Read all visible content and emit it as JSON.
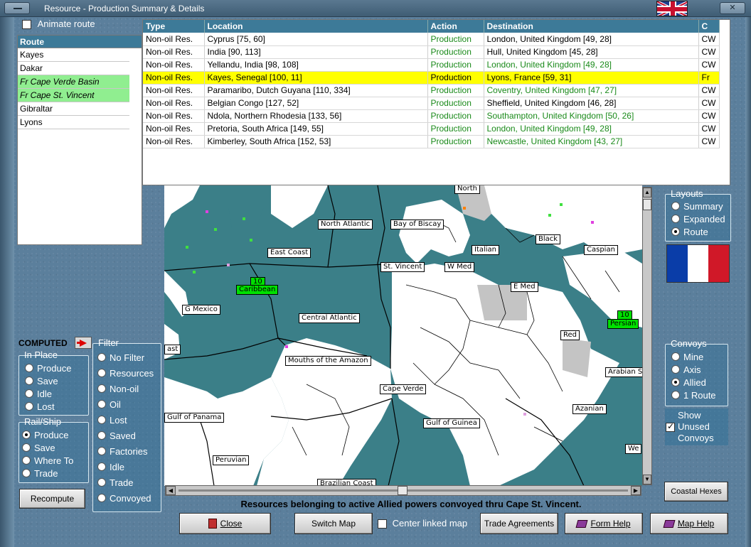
{
  "window": {
    "title": "Resource - Production Summary & Details"
  },
  "animate_route": {
    "label": "Animate route",
    "checked": false
  },
  "route_list": {
    "header": "Route",
    "items": [
      {
        "label": "Kayes",
        "highlight": false
      },
      {
        "label": "Dakar",
        "highlight": false
      },
      {
        "label": "Fr Cape Verde Basin",
        "highlight": true
      },
      {
        "label": "Fr Cape St. Vincent",
        "highlight": true
      },
      {
        "label": "Gibraltar",
        "highlight": false
      },
      {
        "label": "Lyons",
        "highlight": false
      }
    ]
  },
  "table": {
    "columns": [
      "Type",
      "Location",
      "Action",
      "Destination",
      "C"
    ],
    "rows": [
      [
        "Non-oil Res.",
        "Cyprus [75, 60]",
        "Production",
        "London, United Kingdom [49, 28]",
        "CW"
      ],
      [
        "Non-oil Res.",
        "India [90, 113]",
        "Production",
        "Hull, United Kingdom [45, 28]",
        "CW"
      ],
      [
        "Non-oil Res.",
        "Yellandu, India [98, 108]",
        "Production",
        "London, United Kingdom [49, 28]",
        "CW"
      ],
      [
        "Non-oil Res.",
        "Kayes, Senegal [100, 11]",
        "Production",
        "Lyons, France [59, 31]",
        "Fr"
      ],
      [
        "Non-oil Res.",
        "Paramaribo, Dutch Guyana [110, 334]",
        "Production",
        "Coventry, United Kingdom [47, 27]",
        "CW"
      ],
      [
        "Non-oil Res.",
        "Belgian Congo [127, 52]",
        "Production",
        "Sheffield, United Kingdom [46, 28]",
        "CW"
      ],
      [
        "Non-oil Res.",
        "Ndola, Northern Rhodesia [133, 56]",
        "Production",
        "Southampton, United Kingdom [50, 26]",
        "CW"
      ],
      [
        "Non-oil Res.",
        "Pretoria, South Africa [149, 55]",
        "Production",
        "London, United Kingdom [49, 28]",
        "CW"
      ],
      [
        "Non-oil Res.",
        "Kimberley, South Africa [152, 53]",
        "Production",
        "Newcastle, United Kingdom [43, 27]",
        "CW"
      ]
    ],
    "highlight_row": 3,
    "green_destination_rows": [
      2,
      4,
      6,
      7,
      8
    ]
  },
  "map": {
    "labels": [
      "North",
      "North Atlantic",
      "Bay of Biscay",
      "Black",
      "East Coast",
      "Italian",
      "Caspian",
      "St. Vincent",
      "W Med",
      "E Med",
      "10",
      "Caribbean",
      "G Mexico",
      "Central Atlantic",
      "10",
      "Persian",
      "Red",
      "ast",
      "Mouths of the Amazon",
      "Arabian S",
      "Cape Verde",
      "Gulf of Panama",
      "Gulf of Guinea",
      "Azanian",
      "Peruvian",
      "We",
      "Brazilian Coast"
    ]
  },
  "layouts": {
    "legend": "Layouts",
    "options": [
      "Summary",
      "Expanded",
      "Route"
    ],
    "selected": 2
  },
  "convoys": {
    "legend": "Convoys",
    "options": [
      "Mine",
      "Axis",
      "Allied",
      "1 Route"
    ],
    "selected": 2
  },
  "show_unused": {
    "label_lines": [
      "Show",
      "Unused",
      "Convoys"
    ],
    "checked": true
  },
  "computed": {
    "label": "COMPUTED"
  },
  "in_place": {
    "legend": "In Place",
    "options": [
      "Produce",
      "Save",
      "Idle",
      "Lost"
    ],
    "selected": -1
  },
  "rail_ship": {
    "legend": "Rail/Ship",
    "options": [
      "Produce",
      "Save",
      "Where To",
      "Trade"
    ],
    "selected": 0
  },
  "filter": {
    "legend": "Filter",
    "options": [
      "No Filter",
      "Resources",
      "Non-oil",
      "Oil",
      "Lost",
      "Saved",
      "Factories",
      "Idle",
      "Trade",
      "Convoyed"
    ],
    "selected": -1
  },
  "buttons": {
    "recompute": "Recompute",
    "close": "Close",
    "switch_map": "Switch Map",
    "center_linked_map": "Center linked map",
    "trade_agreements": "Trade Agreements",
    "form_help": "Form Help",
    "map_help": "Map Help",
    "coastal_hexes": "Coastal Hexes"
  },
  "status_text": "Resources belonging to active Allied powers convoyed thru Cape St. Vincent.",
  "colors": {
    "sea": "#3b7f88",
    "land": "#ffffff",
    "neutral_land": "#c4c4c4",
    "highlight_row": "#ffff00",
    "green_text": "#1a8a1a",
    "route_highlight": "#90ee90",
    "table_header": "#3d7a98",
    "france_blue": "#0a3da8",
    "france_white": "#ffffff",
    "france_red": "#d01828"
  }
}
